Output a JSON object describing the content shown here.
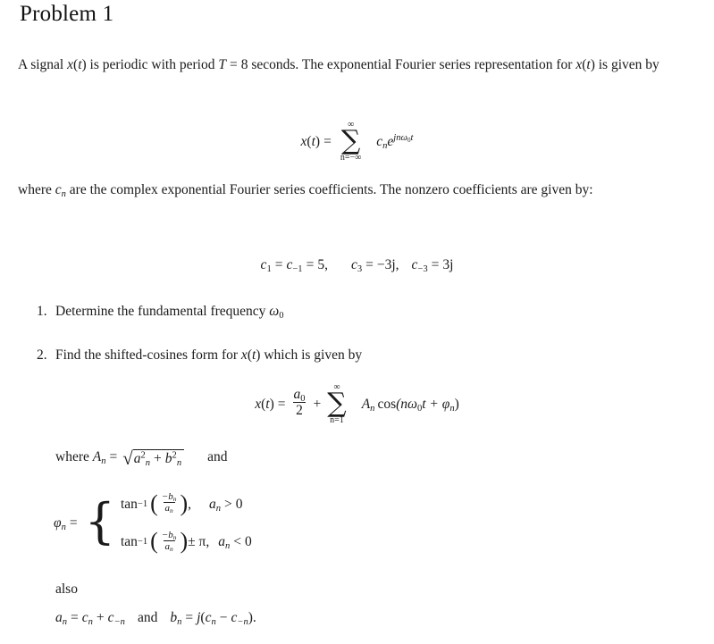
{
  "document": {
    "heading": "Problem 1",
    "paragraph_1": {
      "text_before_signal": "A signal ",
      "signal_symbol": "x",
      "text_periodic": " is periodic with period ",
      "period_symbol": "T",
      "period_equals": "=",
      "period_value": "8",
      "text_seconds": " seconds.  The exponential Fourier series representation for ",
      "text_given_by": " is given by"
    },
    "equation_1": {
      "lhs": "x",
      "equals": "=",
      "sum_upper": "∞",
      "sum_symbol": "∑",
      "sum_lower": "n=−∞",
      "coefficient": "c",
      "coefficient_sub": "n",
      "exponential_base": "e",
      "exponent": "jnω",
      "exponent_sub": "0",
      "exponent_tail": "t"
    },
    "paragraph_2": {
      "text_where": "where ",
      "coefficient_symbol": "c",
      "coefficient_sub": "n",
      "text_rest": " are the complex exponential Fourier series coefficients.  The nonzero coefficients are given by:"
    },
    "equation_2": {
      "c1": "c",
      "c1_sub": "1",
      "eq1": "=",
      "cm1": "c",
      "cm1_sub": "−1",
      "eq2": "=",
      "val1": "5,",
      "c3": "c",
      "c3_sub": "3",
      "eq3": "=",
      "val3": "−3j,",
      "cm3": "c",
      "cm3_sub": "−3",
      "eq4": "=",
      "val_m3": "3j"
    },
    "list": [
      {
        "number": "1.",
        "text_before": "Determine the fundamental frequency ",
        "symbol": "ω",
        "symbol_sub": "0",
        "text_after": ""
      },
      {
        "number": "2.",
        "text_before": "Find the shifted-cosines form for ",
        "symbol": "x",
        "symbol_arg": "(t)",
        "text_after": " which is given by"
      }
    ],
    "equation_3": {
      "lhs": "x",
      "equals": "=",
      "frac_num": "a",
      "frac_num_sub": "0",
      "frac_den": "2",
      "plus": "+",
      "sum_upper": "∞",
      "sum_symbol": "∑",
      "sum_lower": "n=1",
      "amplitude": "A",
      "amplitude_sub": "n",
      "cos": "cos",
      "arg": "(nω",
      "arg_sub": "0",
      "arg_mid": "t + φ",
      "arg_sub2": "n",
      "arg_close": ")"
    },
    "amplitude_def": {
      "text_where": "where ",
      "symbol": "A",
      "symbol_sub": "n",
      "equals": "=",
      "radical": "√",
      "radicand_a": "a",
      "radicand_a_sub": "n",
      "radicand_a_sup": "2",
      "plus": "+",
      "radicand_b": "b",
      "radicand_b_sub": "n",
      "radicand_b_sup": "2",
      "text_and": "and"
    },
    "phase_def": {
      "lhs": "φ",
      "lhs_sub": "n",
      "equals": "=",
      "case_1": {
        "fn": "tan",
        "fn_sup": "−1",
        "frac_num": "−b",
        "frac_num_sub": "n",
        "frac_den": "a",
        "frac_den_sub": "n",
        "trailing": ",",
        "condition_lhs": "a",
        "condition_sub": "n",
        "condition_rel": ">",
        "condition_rhs": "0"
      },
      "case_2": {
        "fn": "tan",
        "fn_sup": "−1",
        "frac_num": "−b",
        "frac_num_sub": "n",
        "frac_den": "a",
        "frac_den_sub": "n",
        "trailing": "± π,",
        "condition_lhs": "a",
        "condition_sub": "n",
        "condition_rel": "<",
        "condition_rhs": "0"
      }
    },
    "also_label": "also",
    "coefficient_relations": {
      "a": "a",
      "a_sub": "n",
      "eq1": "=",
      "c": "c",
      "c_sub": "n",
      "plus": "+",
      "cm": "c",
      "cm_sub": "−n",
      "and": "and",
      "b": "b",
      "b_sub": "n",
      "eq2": "=",
      "j": "j",
      "open": "(",
      "c2": "c",
      "c2_sub": "n",
      "minus": "−",
      "cm2": "c",
      "cm2_sub": "−n",
      "close": ").",
      "period_value_note": ""
    }
  },
  "colors": {
    "background": "#ffffff",
    "text": "#1a1a1a"
  }
}
